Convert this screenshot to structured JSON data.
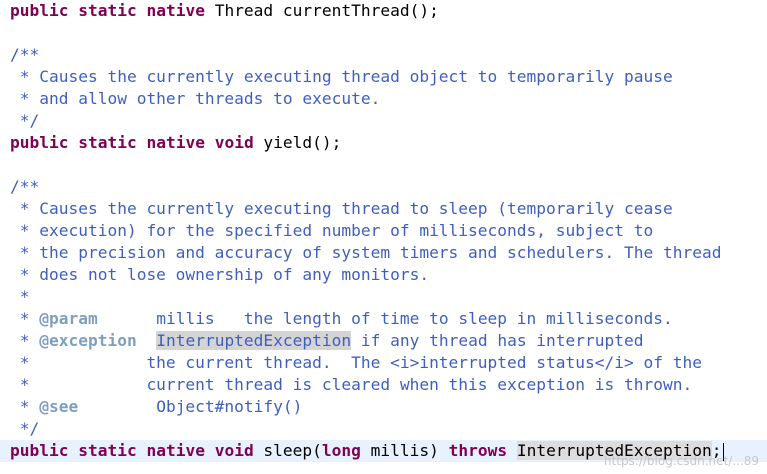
{
  "code": {
    "kw_public": "public",
    "kw_static": "static",
    "kw_native": "native",
    "kw_void": "void",
    "kw_long": "long",
    "kw_throws": "throws",
    "line1_rest": " Thread currentThread();",
    "jd_open": "/**",
    "jd_close": " */",
    "yield_c1": " * Causes the currently executing thread object to temporarily pause",
    "yield_c2": " * and allow other threads to execute.",
    "yield_sig": " yield();",
    "sleep_c1": " * Causes the currently executing thread to sleep (temporarily cease",
    "sleep_c2": " * execution) for the specified number of milliseconds, subject to",
    "sleep_c3": " * the precision and accuracy of system timers and schedulers. The thread",
    "sleep_c4": " * does not lose ownership of any monitors.",
    "star": " *",
    "param_tag": "@param",
    "param_text": "      millis   the length of time to sleep in milliseconds.",
    "exception_tag": "@exception",
    "exception_name": "InterruptedException",
    "exception_text": " if any thread has interrupted",
    "exc_cont1": " *            the current thread.  The <i>interrupted status</i> of the",
    "exc_cont2": " *            current thread is cleared when this exception is thrown.",
    "see_tag": "@see",
    "see_text": "        Object#notify()",
    "sleep_sig_a": " sleep(",
    "sleep_sig_b": " millis) ",
    "sleep_sig_exc": "InterruptedException",
    "sleep_sig_end": ";"
  },
  "watermark": "https://blog.csdn.net/...89"
}
